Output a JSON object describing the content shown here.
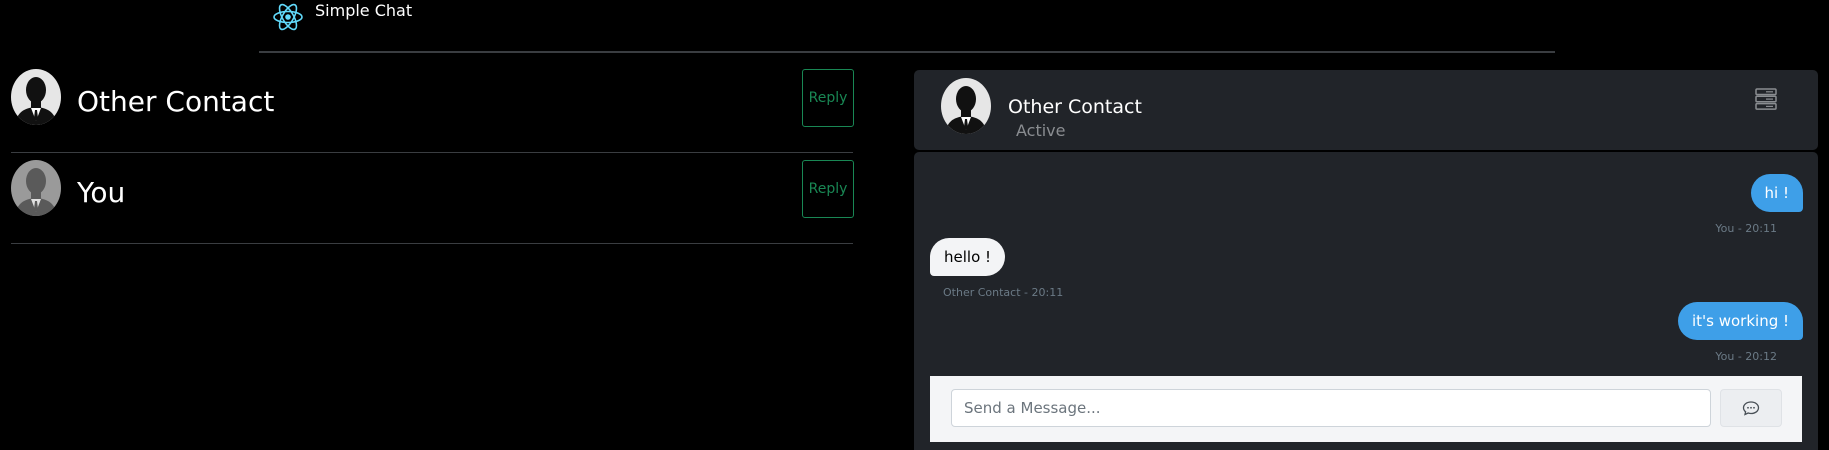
{
  "header": {
    "app_title": "Simple Chat",
    "logo_icon": "react-logo-icon",
    "logo_color": "#61dafb"
  },
  "contacts": [
    {
      "name": "Other Contact",
      "reply_label": "Reply",
      "avatar": "man-in-suit-avatar"
    },
    {
      "name": "You",
      "reply_label": "Reply",
      "avatar": "gray-silhouette-avatar"
    }
  ],
  "chat": {
    "contact_name": "Other Contact",
    "status": "Active",
    "menu_icon": "server-stack-icon",
    "messages": [
      {
        "text": "hi !",
        "meta": "You - 20:11",
        "direction": "sent"
      },
      {
        "text": "hello !",
        "meta": "Other Contact - 20:11",
        "direction": "received"
      },
      {
        "text": "it's working !",
        "meta": "You - 20:12",
        "direction": "sent"
      }
    ],
    "composer": {
      "placeholder": "Send a Message...",
      "value": "",
      "send_icon": "chat-bubble-icon"
    }
  },
  "colors": {
    "background": "#000000",
    "panel": "#212429",
    "sent_bubble": "#3e9fe8",
    "received_bubble": "#f3f4f6",
    "reply_button": "#198754",
    "divider": "#3a3d41"
  }
}
